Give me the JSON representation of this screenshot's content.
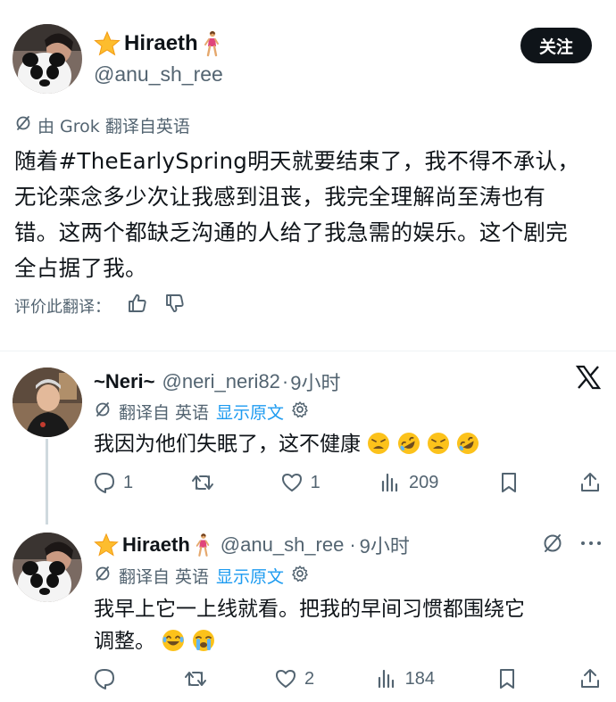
{
  "main_post": {
    "author": {
      "name": "Hiraeth",
      "name_prefix_emoji": "star-emoji",
      "name_suffix_emoji": "walking-woman-emoji",
      "handle": "@anu_sh_ree"
    },
    "follow_label": "关注",
    "translation_note": "由 Grok 翻译自英语",
    "text": "随着#TheEarlySpring明天就要结束了，我不得不承认，无论栾念多少次让我感到沮丧，我完全理解尚至涛也有错。这两个都缺乏沟通的人给了我急需的娱乐。这个剧完全占据了我。",
    "rate_label": "评价此翻译："
  },
  "replies": [
    {
      "name": "~Neri~",
      "handle": "@neri_neri82",
      "separator": "·",
      "time": "9小时",
      "translated_from": "翻译自 英语",
      "show_original": "显示原文",
      "text": "我因为他们失眠了，这不健康",
      "emojis": [
        "weary-face-emoji",
        "rofl-emoji",
        "weary-face-emoji",
        "rofl-emoji"
      ],
      "stats": {
        "replies": "1",
        "retweets": "",
        "likes": "1",
        "views": "209"
      }
    },
    {
      "name": "Hiraeth",
      "handle": "@anu_sh_ree",
      "separator": "·",
      "time": "9小时",
      "translated_from": "翻译自 英语",
      "show_original": "显示原文",
      "text_line1": "我早上它一上线就看。把我的早间习惯都围绕它",
      "text_line2": "调整。",
      "emojis": [
        "joy-face-emoji",
        "loudly-crying-face-emoji"
      ],
      "stats": {
        "replies": "",
        "retweets": "",
        "likes": "2",
        "views": "184"
      }
    }
  ],
  "colors": {
    "text": "#0f1419",
    "secondary": "#536471",
    "link": "#1d9bf0",
    "follow_bg": "#0f1419",
    "divider": "#eff3f4"
  }
}
